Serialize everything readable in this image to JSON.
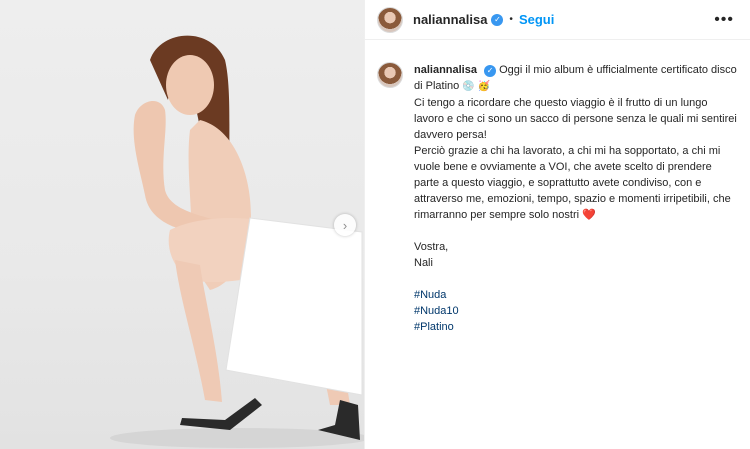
{
  "post": {
    "username": "naliannalisa",
    "follow_label": "Segui",
    "separator": "•",
    "more_label": "•••",
    "next_arrow": "›",
    "verified_mark": "✓"
  },
  "caption": {
    "username": "naliannalisa",
    "line1": "Oggi il mio album è ufficialmente certificato disco di Platino",
    "emoji_disc": "💿",
    "emoji_celebrate": "🥳",
    "para2": "Ci tengo a ricordare che questo viaggio è il frutto di un lungo lavoro e che ci sono un sacco di persone senza le quali mi sentirei davvero persa!",
    "para3": "Perciò grazie a chi ha lavorato, a chi mi ha sopportato, a chi mi vuole bene e ovviamente a VOI, che avete scelto di prendere parte a questo viaggio, e soprattutto avete condiviso, con e attraverso me, emozioni, tempo, spazio e momenti irripetibili, che rimarranno per sempre solo nostri",
    "heart": "❤️",
    "signoff": "Vostra,",
    "signature": "Nali",
    "hashtags": [
      "#Nuda",
      "#Nuda10",
      "#Platino"
    ]
  },
  "colors": {
    "link_blue": "#0095f6",
    "hashtag": "#00376b",
    "verified": "#3897f0",
    "heart": "#e0245e"
  },
  "icons": {
    "verified": "verified-badge-icon",
    "more": "more-options-icon",
    "next": "chevron-right-icon"
  }
}
